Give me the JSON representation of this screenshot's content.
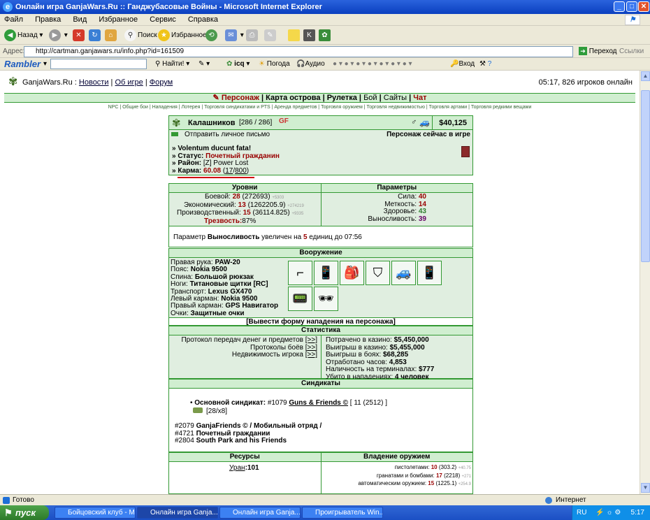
{
  "window": {
    "title": "Онлайн игра GanjaWars.Ru :: Ганджубасовые Войны - Microsoft Internet Explorer",
    "controls": [
      "_",
      "□",
      "✕"
    ]
  },
  "menu": [
    "Файл",
    "Правка",
    "Вид",
    "Избранное",
    "Сервис",
    "Справка"
  ],
  "toolbar": {
    "back": "Назад",
    "search": "Поиск",
    "favorites": "Избранное"
  },
  "address": {
    "label": "Адрес:",
    "url": "http://cartman.ganjawars.ru/info.php?id=161509",
    "go": "Переход",
    "links": "Ссылки"
  },
  "rambler": {
    "logo": "Rambler",
    "find": "Найти!",
    "icq": "icq",
    "weather": "Погода",
    "audio": "Аудио",
    "login": "Вход"
  },
  "site": {
    "name": "GanjaWars.Ru :",
    "nav": [
      "Новости",
      "Об игре",
      "Форум"
    ],
    "online": "05:17, 826 игроков онлайн",
    "topnav": [
      "Персонаж",
      "Карта острова",
      "Рулетка",
      "Бой",
      "Сайты",
      "Чат"
    ],
    "subnav": "NPC | Общие бои | Нападения | Лотерея | Торговля синдикатами и PTS | Аренда предметов | Торговля оружием | Торговля недвижимостью | Торговля артами | Торговля редкими вещами"
  },
  "player": {
    "name": "Калашников",
    "hp": "[286 / 286]",
    "badge": "GF",
    "money": "$40,125",
    "send_mail": "Отправить личное письмо",
    "online_status": "Персонаж сейчас в игре",
    "motto": "» Volentum ducunt fata!",
    "status_label": "» Статус:",
    "status_value": "Почетный гражданин",
    "district_label": "» Район:",
    "district_value": "[Z] Power Lost",
    "karma_label": "» Карма:",
    "karma_value": "60.08",
    "karma_a": "17",
    "karma_b": "800"
  },
  "levels": {
    "header": "Уровни",
    "rows": [
      {
        "label": "Боевой:",
        "lvl": "28",
        "val": "(272693)",
        "add": "+5303"
      },
      {
        "label": "Экономический:",
        "lvl": "13",
        "val": "(1262205.9)",
        "add": "+274219"
      },
      {
        "label": "Производственный:",
        "lvl": "15",
        "val": "(36114.825)",
        "add": "+9335"
      }
    ],
    "sober_label": "Трезвость:",
    "sober_value": "87%"
  },
  "params": {
    "header": "Параметры",
    "rows": [
      {
        "label": "Сила:",
        "val": "40"
      },
      {
        "label": "Меткость:",
        "val": "14"
      },
      {
        "label": "Здоровье:",
        "val": "43"
      },
      {
        "label": "Выносливость:",
        "val": "39"
      }
    ]
  },
  "param_note": {
    "pre": "Параметр",
    "param": "Выносливость",
    "mid": "увеличен на",
    "amount": "5",
    "post": "единиц до 07:56"
  },
  "weapons": {
    "header": "Вооружение",
    "rows": [
      {
        "label": "Правая рука:",
        "val": "PAW-20"
      },
      {
        "label": "Пояс:",
        "val": "Nokia 9500"
      },
      {
        "label": "Спина:",
        "val": "Большой рюкзак"
      },
      {
        "label": "Ноги:",
        "val": "Титановые щитки [RC]"
      },
      {
        "label": "Транспорт:",
        "val": "Lexus GX470"
      },
      {
        "label": "Левый карман:",
        "val": "Nokia 9500"
      },
      {
        "label": "Правый карман:",
        "val": "GPS Навигатор"
      },
      {
        "label": "Очки:",
        "val": "Защитные очки"
      }
    ]
  },
  "attack_form": "[Вывести форму нападения на персонажа]",
  "stats": {
    "header": "Статистика",
    "left": [
      "Протокол передач денег и предметов",
      "Протоколы боёв",
      "Недвижимость игрока"
    ],
    "link": "[>>]",
    "right": [
      {
        "label": "Потрачено в казино:",
        "val": "$5,450,000"
      },
      {
        "label": "Выигрыш в казино:",
        "val": "$5,455,000"
      },
      {
        "label": "Выигрыш в боях:",
        "val": "$68,285"
      },
      {
        "label": "Отработано часов:",
        "val": "4,853"
      },
      {
        "label": "Наличность на терминалах:",
        "val": "$777"
      },
      {
        "label": "Убито в нападениях:",
        "val": "4 человек"
      }
    ]
  },
  "syndicates": {
    "header": "Синдикаты",
    "main_label": "Основной синдикат:",
    "main_num": "#1079",
    "main_name": "Guns & Friends ©",
    "main_lvl": "[ 11 (2512) ]",
    "main_rank": "[28/x8]",
    "others": [
      {
        "num": "#2079",
        "name": "GanjaFriends © / Мобильный отряд /"
      },
      {
        "num": "#4721",
        "name": "Почетный граждании"
      },
      {
        "num": "#2804",
        "name": "South Park and his Friends"
      }
    ]
  },
  "resources": {
    "header": "Ресурсы",
    "label": "Уран",
    "val": ":101"
  },
  "weapon_skill": {
    "header": "Владение оружием",
    "rows": [
      {
        "label": "пистолетами:",
        "lvl": "10",
        "val": "(303.2)",
        "add": "+40.75"
      },
      {
        "label": "гранатами и бомбами:",
        "lvl": "17",
        "val": "(2218)",
        "add": "+271"
      },
      {
        "label": "автоматическим оружием:",
        "lvl": "15",
        "val": "(1225.1)",
        "add": "+254.9"
      }
    ]
  },
  "status": {
    "left": "Готово",
    "zone": "Интернет"
  },
  "taskbar": {
    "start": "пуск",
    "tasks": [
      "Бойцовский клуб - M...",
      "Онлайн игра Ganja...",
      "Онлайн игра Ganja...",
      "Проигрыватель Win..."
    ],
    "lang": "RU",
    "clock": "5:17"
  }
}
